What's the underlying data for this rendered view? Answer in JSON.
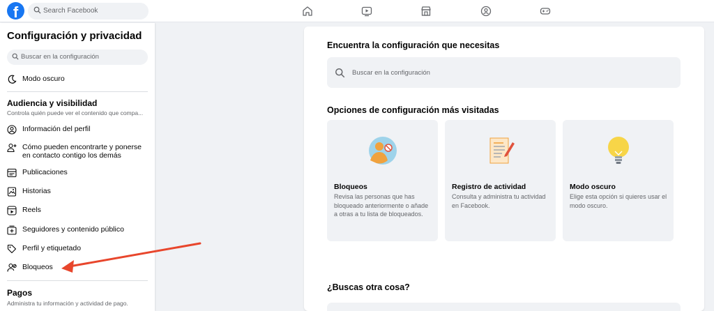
{
  "topbar": {
    "search_placeholder": "Search Facebook",
    "logo_letter": "f",
    "nav_icons": [
      "home-icon",
      "video-icon",
      "marketplace-icon",
      "groups-icon",
      "gaming-icon"
    ]
  },
  "sidebar": {
    "title": "Configuración y privacidad",
    "search_placeholder": "Buscar en la configuración",
    "dark_mode": "Modo oscuro",
    "section_audience": {
      "title": "Audiencia y visibilidad",
      "subtitle": "Controla quién puede ver el contenido que compa..."
    },
    "items": [
      {
        "label": "Información del perfil",
        "icon": "profile-icon"
      },
      {
        "label": "Cómo pueden encontrarte y ponerse",
        "label2": "en contacto contigo los demás",
        "icon": "add-friend-icon"
      },
      {
        "label": "Publicaciones",
        "icon": "posts-icon"
      },
      {
        "label": "Historias",
        "icon": "stories-icon"
      },
      {
        "label": "Reels",
        "icon": "reels-icon"
      },
      {
        "label": "Seguidores y contenido público",
        "icon": "followers-icon"
      },
      {
        "label": "Perfil y etiquetado",
        "icon": "tag-icon"
      },
      {
        "label": "Bloqueos",
        "icon": "block-user-icon"
      }
    ],
    "section_payments": {
      "title": "Pagos",
      "subtitle": "Administra tu información y actividad de pago."
    }
  },
  "main": {
    "find_heading": "Encuentra la configuración que necesitas",
    "search_placeholder": "Buscar en la configuración",
    "popular_heading": "Opciones de configuración más visitadas",
    "cards": [
      {
        "title": "Bloqueos",
        "desc": "Revisa las personas que has bloqueado anteriormente o añade a otras a tu lista de bloqueados.",
        "icon": "blocked-user-illustration"
      },
      {
        "title": "Registro de actividad",
        "desc": "Consulta y administra tu actividad en Facebook.",
        "icon": "activity-log-illustration"
      },
      {
        "title": "Modo oscuro",
        "desc": "Elige esta opción si quieres usar el modo oscuro.",
        "icon": "lightbulb-illustration"
      }
    ],
    "other_heading": "¿Buscas otra cosa?"
  },
  "colors": {
    "brand": "#1877f2",
    "annotation_arrow": "#e8462c",
    "background": "#f0f2f5"
  }
}
